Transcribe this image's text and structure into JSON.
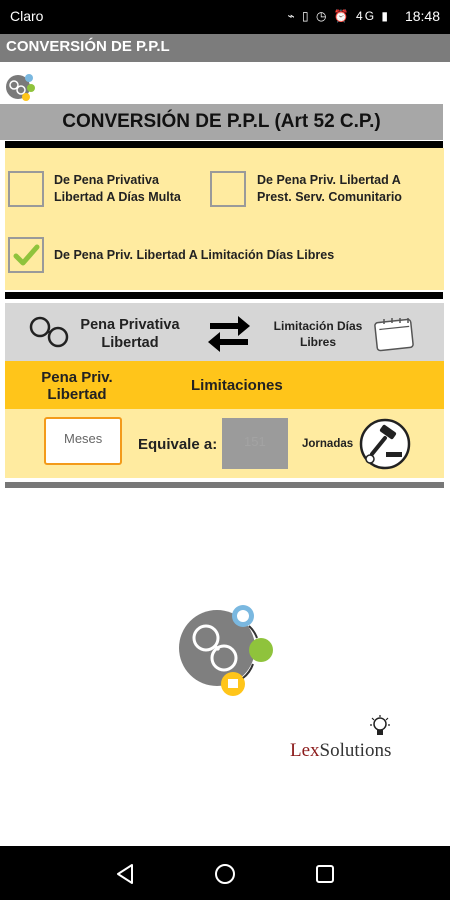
{
  "status_bar": {
    "carrier": "Claro",
    "time": "18:48",
    "icons": "⌁ ▯ ◷ ⏰ 4G ▮"
  },
  "app_bar": {
    "title": "CONVERSIÓN DE P.P.L"
  },
  "header": {
    "title": "CONVERSIÓN DE P.P.L (Art 52 C.P.)"
  },
  "options": {
    "opt1": {
      "line1": "De Pena Privativa",
      "line2": "Libertad A Días Multa",
      "checked": false
    },
    "opt2": {
      "line1": "De Pena Priv. Libertad A",
      "line2": "Prest. Serv. Comunitario",
      "checked": false
    },
    "opt3": {
      "label": "De Pena Priv. Libertad A Limitación Días Libres",
      "checked": true
    }
  },
  "conversion": {
    "from_line1": "Pena Privativa",
    "from_line2": "Libertad",
    "to_line1": "Limitación Días",
    "to_line2": "Libres"
  },
  "columns": {
    "left_line1": "Pena Priv.",
    "left_line2": "Libertad",
    "right": "Limitaciones"
  },
  "input": {
    "placeholder": "Meses",
    "equivale": "Equivale a:",
    "result_placeholder": "151",
    "unit": "Jornadas"
  },
  "brand": {
    "part1": "Lex",
    "part2": "Solutions"
  },
  "colors": {
    "accent_orange": "#ffc51a",
    "panel_yellow": "#ffeba0",
    "check_green": "#8fc33c",
    "brand_red": "#8b1a1a"
  }
}
